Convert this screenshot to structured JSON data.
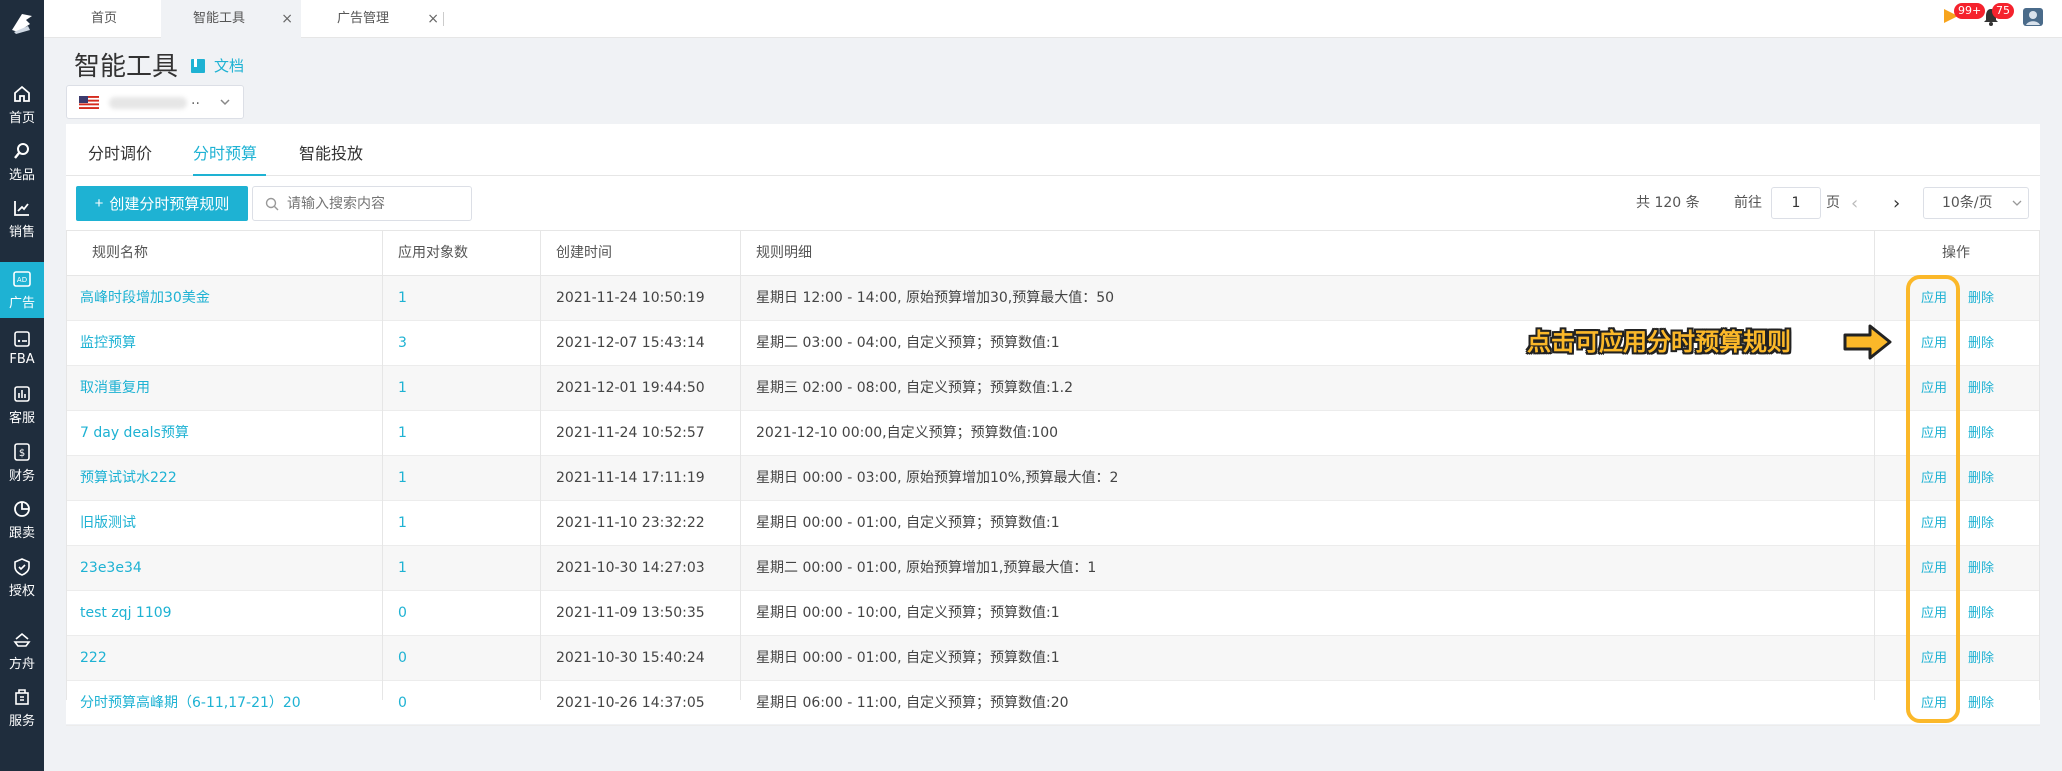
{
  "sidebar": {
    "items": [
      {
        "label": "首页",
        "icon": "home-icon"
      },
      {
        "label": "选品",
        "icon": "search-icon"
      },
      {
        "label": "销售",
        "icon": "chart-icon"
      },
      {
        "label": "广告",
        "icon": "ad-icon"
      },
      {
        "label": "FBA",
        "icon": "fba-icon"
      },
      {
        "label": "客服",
        "icon": "service-icon"
      },
      {
        "label": "财务",
        "icon": "finance-icon"
      },
      {
        "label": "跟卖",
        "icon": "pie-icon"
      },
      {
        "label": "授权",
        "icon": "shield-icon"
      },
      {
        "label": "方舟",
        "icon": "ark-icon"
      },
      {
        "label": "服务",
        "icon": "building-icon"
      }
    ]
  },
  "topbar": {
    "tabs": [
      {
        "label": "首页"
      },
      {
        "label": "智能工具",
        "close": "×"
      },
      {
        "label": "广告管理",
        "close": "×"
      }
    ],
    "notifications_badge": "99+",
    "messages_badge": "75"
  },
  "header": {
    "title": "智能工具",
    "doc_link": "文档",
    "store_ellipsis": ".."
  },
  "subtabs": [
    "分时调价",
    "分时预算",
    "智能投放"
  ],
  "toolbar": {
    "create_label": "创建分时预算规则",
    "search_placeholder": "请输入搜索内容",
    "total": "共 120 条",
    "goto_label": "前往",
    "page": "1",
    "page_unit": "页",
    "page_size": "10条/页"
  },
  "table": {
    "headers": [
      "规则名称",
      "应用对象数",
      "创建时间",
      "规则明细",
      "操作"
    ],
    "apply_label": "应用",
    "delete_label": "删除",
    "rows": [
      {
        "name": "高峰时段增加30美金",
        "count": "1",
        "created": "2021-11-24 10:50:19",
        "detail": "星期日 12:00 - 14:00, 原始预算增加30,预算最大值：50"
      },
      {
        "name": "监控预算",
        "count": "3",
        "created": "2021-12-07 15:43:14",
        "detail": "星期二 03:00 - 04:00, 自定义预算；预算数值:1"
      },
      {
        "name": "取消重复用",
        "count": "1",
        "created": "2021-12-01 19:44:50",
        "detail": "星期三 02:00 - 08:00, 自定义预算；预算数值:1.2"
      },
      {
        "name": "7 day deals预算",
        "count": "1",
        "created": "2021-11-24 10:52:57",
        "detail": "2021-12-10 00:00,自定义预算；预算数值:100"
      },
      {
        "name": "预算试试水222",
        "count": "1",
        "created": "2021-11-14 17:11:19",
        "detail": "星期日 00:00 - 03:00, 原始预算增加10%,预算最大值：2"
      },
      {
        "name": "旧版测试",
        "count": "1",
        "created": "2021-11-10 23:32:22",
        "detail": "星期日 00:00 - 01:00, 自定义预算；预算数值:1"
      },
      {
        "name": "23e3e34",
        "count": "1",
        "created": "2021-10-30 14:27:03",
        "detail": "星期二 00:00 - 01:00, 原始预算增加1,预算最大值：1"
      },
      {
        "name": "test zqj 1109",
        "count": "0",
        "created": "2021-11-09 13:50:35",
        "detail": "星期日 00:00 - 10:00, 自定义预算；预算数值:1"
      },
      {
        "name": "222",
        "count": "0",
        "created": "2021-10-30 15:40:24",
        "detail": "星期日 00:00 - 01:00, 自定义预算；预算数值:1"
      },
      {
        "name": "分时预算高峰期（6-11,17-21）20",
        "count": "0",
        "created": "2021-10-26 14:37:05",
        "detail": "星期日 06:00 - 11:00, 自定义预算；预算数值:20"
      }
    ]
  },
  "annotation": {
    "callout": "点击可应用分时预算规则",
    "color": "#fbb829"
  },
  "colors": {
    "accent": "#1eb2d3",
    "sidebar": "#1f2d3d"
  }
}
